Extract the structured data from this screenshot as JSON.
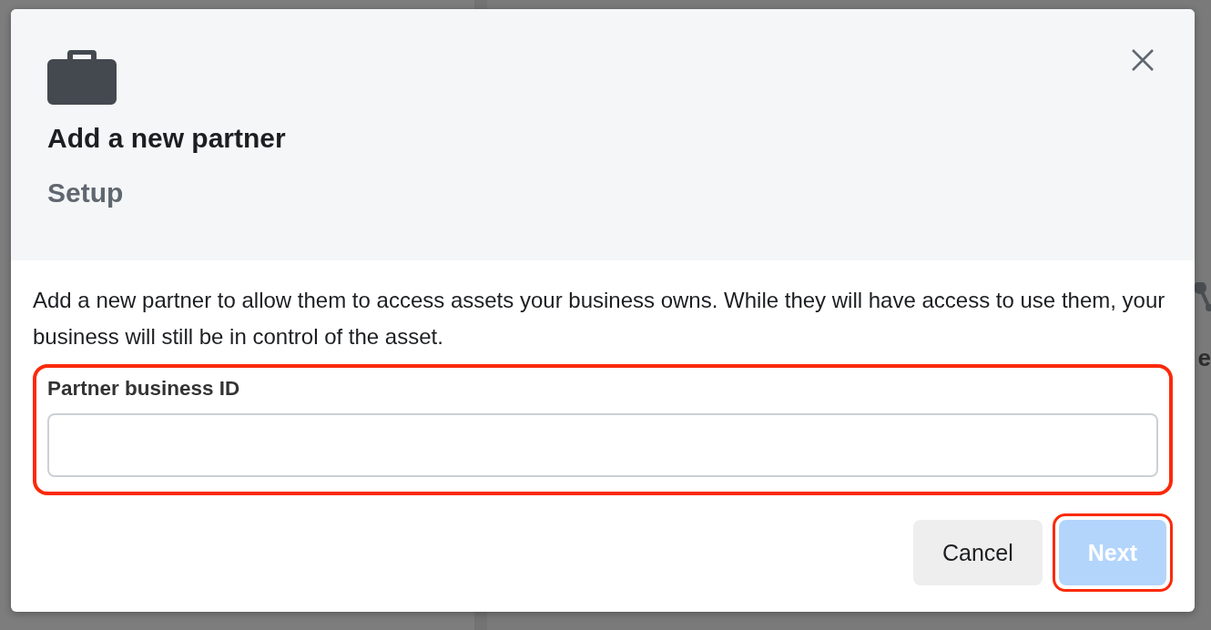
{
  "background": {
    "side_label": "e"
  },
  "dialog": {
    "title": "Add a new partner",
    "subtitle": "Setup",
    "description": "Add a new partner to allow them to access assets your business owns. While they will have access to use them, your business will still be in control of the asset.",
    "field": {
      "label": "Partner business ID",
      "highlighted": true
    },
    "buttons": [
      {
        "label": "Cancel",
        "kind": "secondary",
        "disabled": false,
        "highlighted": false
      },
      {
        "label": "Next",
        "kind": "primary",
        "disabled": true,
        "highlighted": true
      }
    ]
  }
}
